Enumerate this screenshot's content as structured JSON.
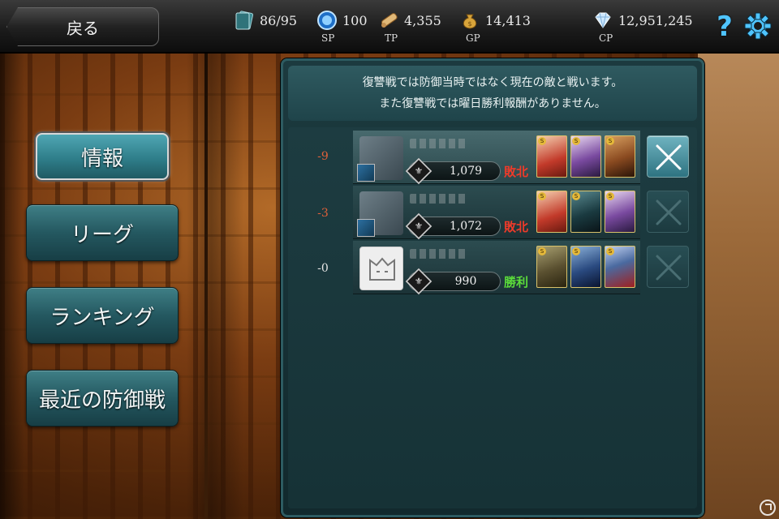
{
  "header": {
    "back_label": "戻る",
    "stats": [
      {
        "icon": "card-stack-icon",
        "value": "86/95",
        "label": ""
      },
      {
        "icon": "sp-orb-icon",
        "value": "100",
        "label": "SP"
      },
      {
        "icon": "tp-scroll-icon",
        "value": "4,355",
        "label": "TP"
      },
      {
        "icon": "gold-bag-icon",
        "value": "14,413",
        "label": "GP"
      },
      {
        "icon": "diamond-icon",
        "value": "12,951,245",
        "label": "CP"
      }
    ],
    "help_glyph": "?"
  },
  "menu": {
    "items": [
      {
        "label": "情報",
        "active": true
      },
      {
        "label": "リーグ",
        "active": false
      },
      {
        "label": "ランキング",
        "active": false
      },
      {
        "label": "最近の防御戦",
        "active": false
      }
    ]
  },
  "notice": {
    "line1": "復讐戦では防御当時ではなく現在の敵と戦います。",
    "line2": "また復讐戦では曜日勝利報酬がありません。"
  },
  "battles": [
    {
      "score": "-9",
      "rank": "1,079",
      "result": "敗北",
      "outcome": "loss",
      "revenge_enabled": true
    },
    {
      "score": "-3",
      "rank": "1,072",
      "result": "敗北",
      "outcome": "loss",
      "revenge_enabled": false
    },
    {
      "score": "-0",
      "rank": "990",
      "result": "勝利",
      "outcome": "win",
      "revenge_enabled": false
    }
  ],
  "colors": {
    "loss": "#ee3b2a",
    "win": "#5bdc3a",
    "accent": "#2f7e8a"
  }
}
